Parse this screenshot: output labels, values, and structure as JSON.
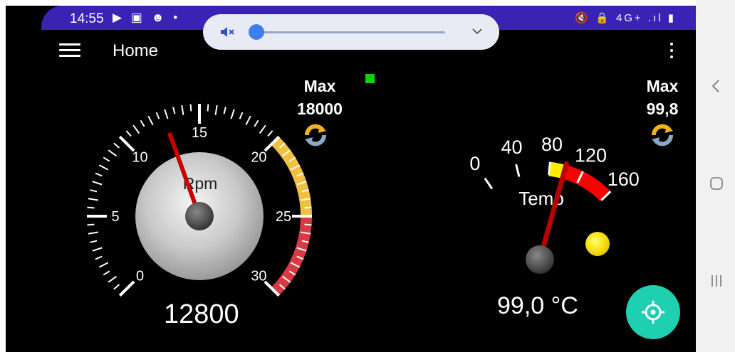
{
  "status_bar": {
    "time": "14:55",
    "left_icons": "▶ ▣ ☻ •",
    "right_icons": "🔇 🔒 4G+ .ıl ▮"
  },
  "volume": {
    "level": 0.02
  },
  "app_bar": {
    "title": "Home"
  },
  "rpm_gauge": {
    "label": "Rpm",
    "unit_scale": "x1000",
    "ticks": [
      "0",
      "5",
      "10",
      "15",
      "20",
      "25",
      "30"
    ],
    "min": 0,
    "max": 30,
    "value_thousands": 12.8,
    "readout": "12800",
    "max_title": "Max",
    "max_value": "18000",
    "zone_yellow_from": 20,
    "zone_red_from": 25,
    "colors": {
      "yellow": "#f0c040",
      "red": "#d83a44"
    }
  },
  "temp_gauge": {
    "label": "Temp",
    "ticks": [
      "0",
      "40",
      "80",
      "120",
      "160"
    ],
    "min": 0,
    "max": 160,
    "value": 99.0,
    "readout": "99,0 °C",
    "max_title": "Max",
    "max_value": "99,8",
    "zone_yellow": [
      80,
      100
    ],
    "zone_red": [
      100,
      160
    ],
    "colors": {
      "yellow": "#ffee00",
      "red": "#ff0000"
    }
  },
  "indicators": {
    "status_dot_color": "#14d014",
    "warning_led_color": "#f2d400"
  },
  "fab": {
    "icon": "crosshair-icon",
    "color": "#1fd0b0"
  }
}
